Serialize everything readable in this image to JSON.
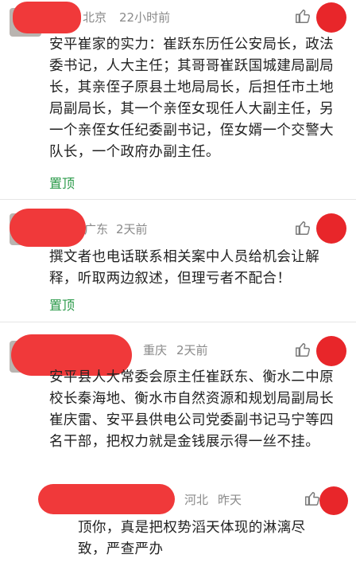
{
  "comments": [
    {
      "location": "北京",
      "time": "22小时前",
      "text": "安平崔家的实力：崔跃东历任公安局长，政法委书记，人大主任；其哥哥崔跃国城建局副局长，其亲侄子原县土地局局长，后担任市土地局副局长，其一个亲侄女现任人大副主任，另一个亲侄女任纪委副书记，侄女婿一个交警大队长，一个政府办副主任。",
      "pin_label": "置顶"
    },
    {
      "location": "广东",
      "time": "2天前",
      "text": "撰文者也电话联系相关案中人员给机会让解释，听取两边叙述，但理亏者不配合！",
      "pin_label": "置顶"
    },
    {
      "location": "重庆",
      "time": "2天前",
      "text": "安平县人大常委会原主任崔跃东、衡水二中原校长秦海地、衡水市自然资源和规划局副局长崔庆雷、安平县供电公司党委副书记马宁等四名干部，把权力就是金钱展示得一丝不挂。"
    }
  ],
  "reply": {
    "location": "河北",
    "time": "昨天",
    "text": "顶你，真是把权势滔天体现的淋漓尽致，严查严办"
  },
  "colors": {
    "redaction": "#f0393a",
    "like_dot": "#e8262a",
    "pin_text": "#2b9a4a",
    "meta_text": "#8a8a8a"
  },
  "icons": {
    "like": "thumbs-up-icon"
  }
}
